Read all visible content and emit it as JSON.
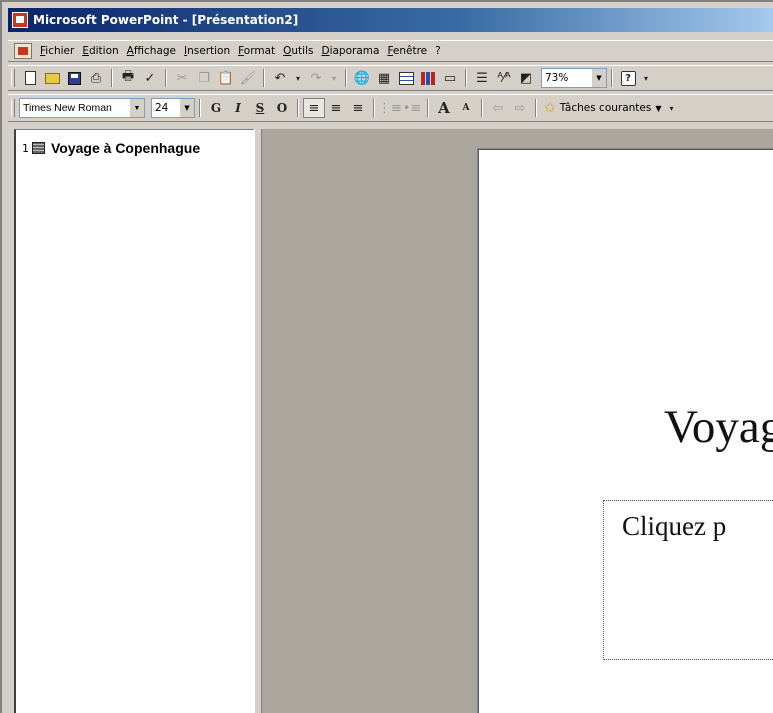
{
  "window": {
    "title": "Microsoft PowerPoint - [Présentation2]"
  },
  "menu": [
    "Fichier",
    "Edition",
    "Affichage",
    "Insertion",
    "Format",
    "Outils",
    "Diaporama",
    "Fenêtre",
    "?"
  ],
  "toolbar_standard": {
    "zoom": "73%",
    "icons": [
      "new-icon",
      "open-icon",
      "save-icon",
      "permission-icon",
      "print-icon",
      "spelling-icon",
      "cut-icon",
      "copy-icon",
      "paste-icon",
      "format-painter-icon",
      "undo-icon",
      "redo-icon",
      "hyperlink-icon",
      "tables-borders-icon",
      "insert-table-icon",
      "insert-chart-icon",
      "new-slide-icon",
      "expand-all-icon",
      "show-formatting-icon",
      "grayscale-icon",
      "help-icon"
    ]
  },
  "toolbar_formatting": {
    "font": "Times New Roman",
    "size": "24",
    "bold": "G",
    "italic": "I",
    "underline": "S",
    "shadow": "O",
    "increase_font": "A",
    "decrease_font": "A",
    "tasks_label": "Tâches courantes"
  },
  "outline": {
    "slide_number": "1",
    "slide_title": "Voyage à Copenhague"
  },
  "slide": {
    "title_visible": "Voyag",
    "subtitle_visible": "Cliquez p"
  },
  "colors": {
    "titlebar": "#0a246a",
    "workspace": "#aba69d",
    "chrome": "#d4d0c8"
  }
}
